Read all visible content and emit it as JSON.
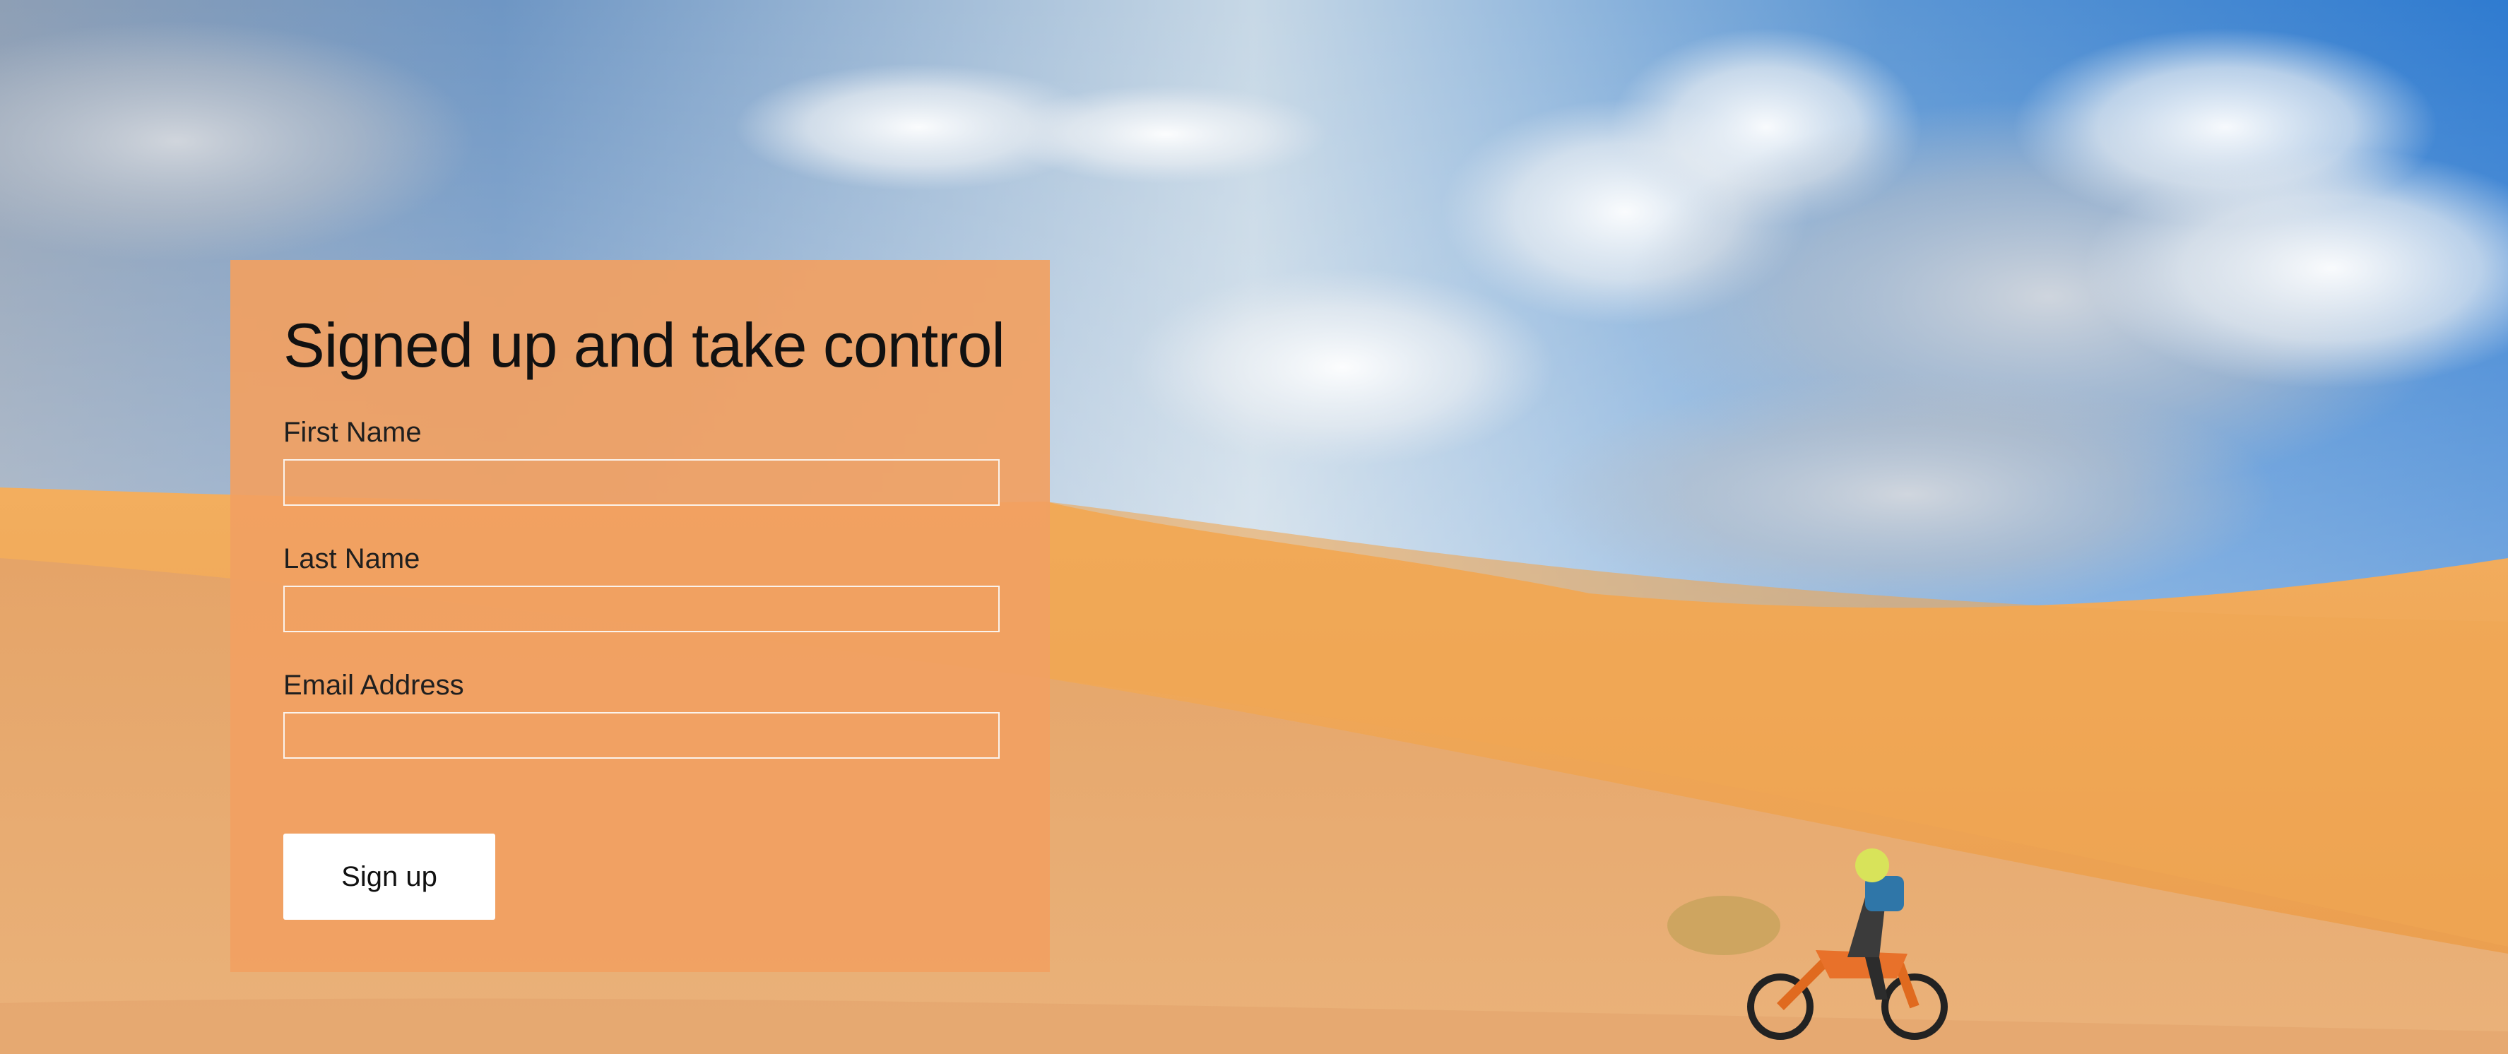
{
  "form": {
    "title": "Signed up and take control",
    "fields": [
      {
        "label": "First Name",
        "value": "",
        "placeholder": ""
      },
      {
        "label": "Last Name",
        "value": "",
        "placeholder": ""
      },
      {
        "label": "Email Address",
        "value": "",
        "placeholder": ""
      }
    ],
    "submit_label": "Sign up"
  },
  "colors": {
    "panel_background": "#f1a062",
    "sky_blue": "#3f86cf",
    "sand": "#eea45a",
    "button_background": "#ffffff",
    "input_border": "#fbf3ec"
  }
}
